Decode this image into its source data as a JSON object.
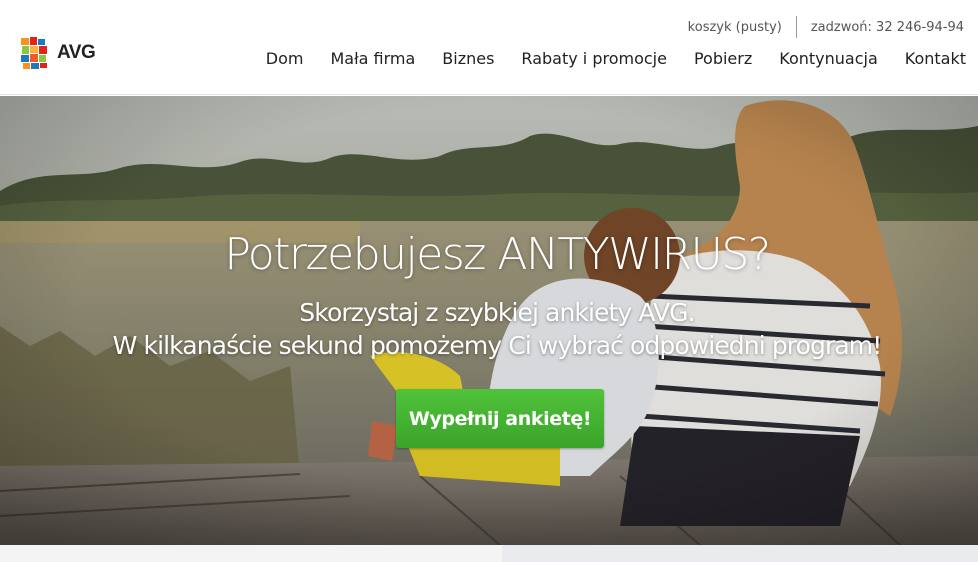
{
  "header": {
    "logo": {
      "text": "AVG",
      "icon": "avg-logo-icon"
    },
    "cart_label": "koszyk (pusty)",
    "phone_label": "zadzwoń: 32 246-94-94",
    "nav": [
      {
        "label": "Dom"
      },
      {
        "label": "Mała firma"
      },
      {
        "label": "Biznes"
      },
      {
        "label": "Rabaty i promocje"
      },
      {
        "label": "Pobierz"
      },
      {
        "label": "Kontynuacja"
      },
      {
        "label": "Kontakt"
      }
    ]
  },
  "hero": {
    "headline": "Potrzebujesz ANTYWIRUS?",
    "subline1": "Skorzystaj z szybkiej ankiety AVG.",
    "subline2": "W kilkanaście sekund pomożemy Ci wybrać odpowiedni program!",
    "cta_label": "Wypełnij ankietę!",
    "background": "photo-mother-child-on-jetty",
    "colors": {
      "cta": "#45b432",
      "headline": "#ffffff"
    }
  }
}
